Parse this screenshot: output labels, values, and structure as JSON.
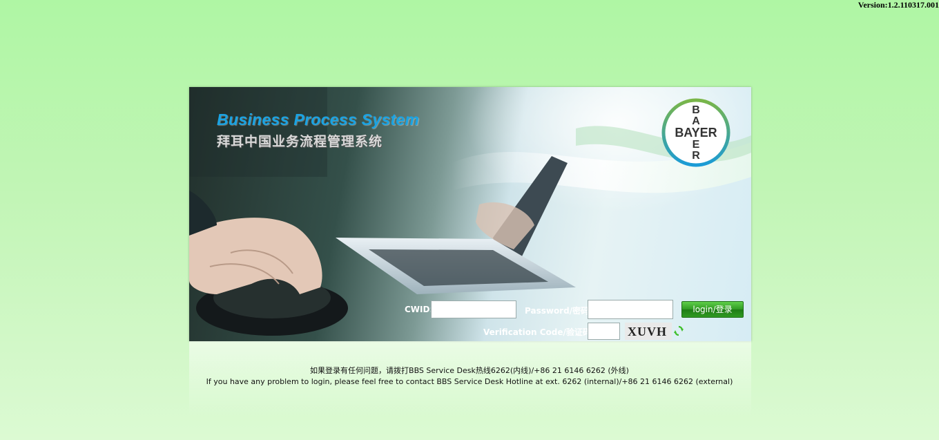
{
  "version": "Version:1.2.110317.001",
  "banner": {
    "title_en": "Business Process System",
    "title_cn": "拜耳中国业务流程管理系统",
    "logo_text": "BAYER",
    "logo_icon": "bayer-cross-logo"
  },
  "login_form": {
    "cwid_label": "CWID:",
    "cwid_value": "",
    "password_label": "Password/密码:",
    "password_value": "",
    "verification_label": "Verification Code/验证码:",
    "verification_value": "",
    "captcha_text": "XUVH",
    "refresh_icon": "refresh-icon",
    "login_button": "login/登录"
  },
  "footer": {
    "line_cn": "如果登录有任何问题，请拨打BBS Service Desk热线6262(内线)/+86 21 6146 6262 (外线)",
    "line_en": "If you have any problem to login, please feel free to contact BBS Service Desk Hotline at ext. 6262 (internal)/+86 21 6146 6262 (external)"
  },
  "colors": {
    "background": "#b2f6a6",
    "title_blue": "#1aa3e3",
    "button_green": "#2f9a22",
    "logo_green": "#7ab648",
    "logo_blue": "#1a9bd7"
  }
}
